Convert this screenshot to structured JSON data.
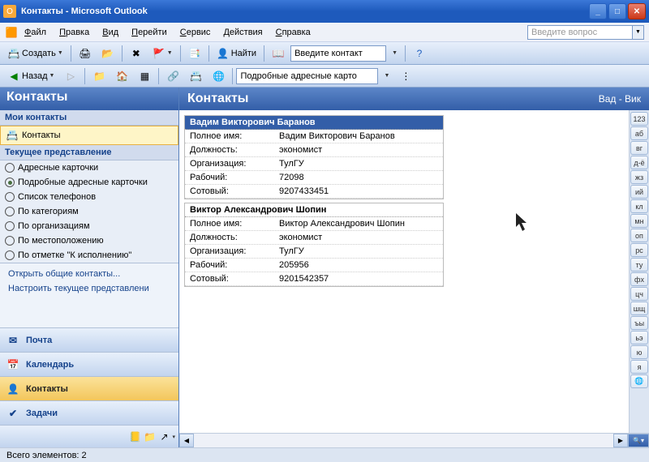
{
  "window": {
    "title": "Контакты - Microsoft Outlook"
  },
  "menu": {
    "items": [
      "Файл",
      "Правка",
      "Вид",
      "Перейти",
      "Сервис",
      "Действия",
      "Справка"
    ],
    "help_search_placeholder": "Введите вопрос"
  },
  "toolbar1": {
    "create": "Создать",
    "find": "Найти",
    "contact_placeholder": "Введите контакт"
  },
  "toolbar2": {
    "back": "Назад",
    "view_combo": "Подробные адресные карто"
  },
  "sidebar": {
    "header": "Контакты",
    "my_contacts": "Мои контакты",
    "contacts_folder": "Контакты",
    "current_view": "Текущее представление",
    "views": [
      {
        "label": "Адресные карточки",
        "selected": false
      },
      {
        "label": "Подробные адресные карточки",
        "selected": true
      },
      {
        "label": "Список телефонов",
        "selected": false
      },
      {
        "label": "По категориям",
        "selected": false
      },
      {
        "label": "По организациям",
        "selected": false
      },
      {
        "label": "По местоположению",
        "selected": false
      },
      {
        "label": "По отметке \"К исполнению\"",
        "selected": false
      }
    ],
    "links": [
      "Открыть общие контакты...",
      "Настроить текущее представлени"
    ],
    "nav": [
      {
        "label": "Почта",
        "icon": "✉",
        "active": false
      },
      {
        "label": "Календарь",
        "icon": "📅",
        "active": false
      },
      {
        "label": "Контакты",
        "icon": "👤",
        "active": true
      },
      {
        "label": "Задачи",
        "icon": "✔",
        "active": false
      }
    ]
  },
  "content": {
    "header": "Контакты",
    "range": "Вад - Вик",
    "fields": {
      "full_name": "Полное имя:",
      "position": "Должность:",
      "org": "Организация:",
      "work": "Рабочий:",
      "mobile": "Сотовый:"
    },
    "cards": [
      {
        "title": "Вадим Викторович Баранов",
        "selected": true,
        "full_name": "Вадим Викторович Баранов",
        "position": "экономист",
        "org": "ТулГУ",
        "work": "72098",
        "mobile": "9207433451"
      },
      {
        "title": "Виктор Александрович Шопин",
        "selected": false,
        "full_name": "Виктор Александрович Шопин",
        "position": "экономист",
        "org": "ТулГУ",
        "work": "205956",
        "mobile": "9201542357"
      }
    ],
    "alpha": [
      "123",
      "аб",
      "вг",
      "д-ё",
      "жз",
      "ий",
      "кл",
      "мн",
      "оп",
      "рс",
      "ту",
      "фх",
      "цч",
      "шщ",
      "ъы",
      "ьэ",
      "ю",
      "я",
      "🌐"
    ]
  },
  "status": {
    "text": "Всего элементов: 2"
  }
}
